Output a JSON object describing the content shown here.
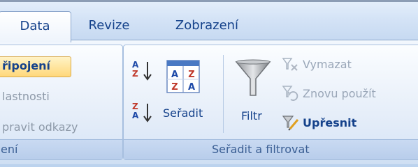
{
  "tabs": [
    {
      "label": "Data",
      "active": true
    },
    {
      "label": "Revize",
      "active": false
    },
    {
      "label": "Zobrazení",
      "active": false
    }
  ],
  "connections_group": {
    "title": "ení",
    "items": [
      {
        "label": "řipojení",
        "enabled": true,
        "highlighted": true
      },
      {
        "label": "lastnosti",
        "enabled": false
      },
      {
        "label": "pravit odkazy",
        "enabled": false
      }
    ]
  },
  "sort_filter_group": {
    "title": "Seřadit a filtrovat",
    "sort_az_icon": "sort-ascending-icon",
    "sort_za_icon": "sort-descending-icon",
    "sort": {
      "label": "Seřadit",
      "icon": "sort-dialog-icon"
    },
    "filter": {
      "label": "Filtr",
      "icon": "funnel-icon"
    },
    "clear": {
      "label": "Vymazat",
      "icon": "clear-filter-icon",
      "enabled": false
    },
    "reapply": {
      "label": "Znovu použít",
      "icon": "reapply-filter-icon",
      "enabled": false
    },
    "advanced": {
      "label": "Upřesnit",
      "icon": "advanced-filter-icon",
      "enabled": true
    }
  },
  "colors": {
    "tab_text": "#15428b",
    "group_title": "#3b5f94",
    "disabled_text": "#9aa7b8",
    "highlight": "#ffd87a"
  }
}
